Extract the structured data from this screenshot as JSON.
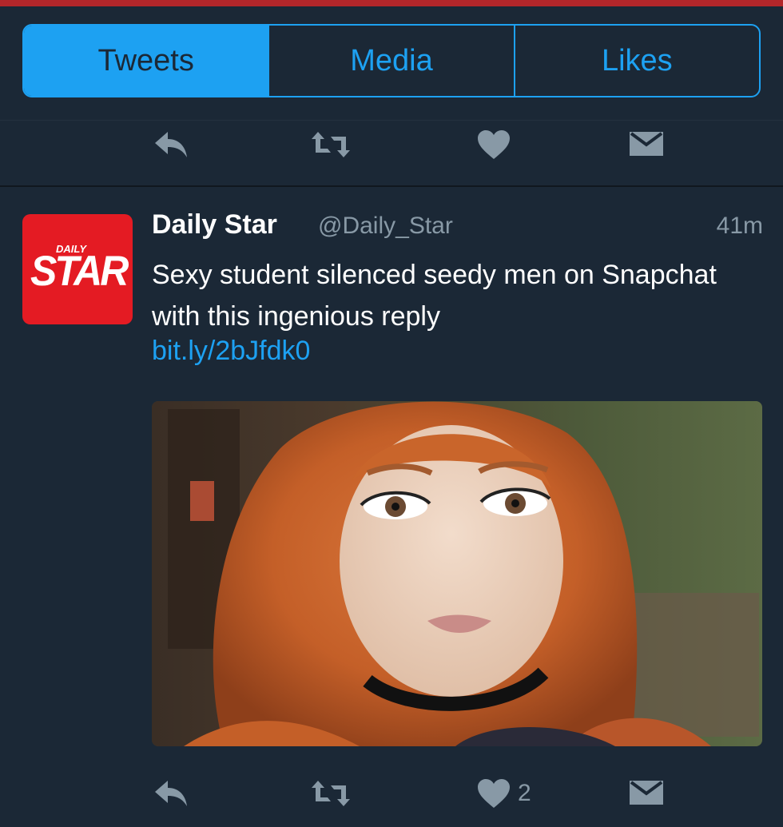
{
  "tabs": [
    {
      "label": "Tweets",
      "active": true
    },
    {
      "label": "Media",
      "active": false
    },
    {
      "label": "Likes",
      "active": false
    }
  ],
  "actions_top": {
    "reply_icon": "reply-icon",
    "retweet_icon": "retweet-icon",
    "like_icon": "heart-icon",
    "dm_icon": "envelope-icon"
  },
  "tweet": {
    "avatar": {
      "small_text": "DAILY",
      "big_text": "STAR",
      "color": "#e41b23"
    },
    "name": "Daily Star",
    "handle": "@Daily_Star",
    "time": "41m",
    "text": "Sexy student silenced seedy men on Snapchat with this ingenious reply",
    "link": "bit.ly/2bJfdk0",
    "actions": {
      "like_count": "2"
    }
  },
  "colors": {
    "background": "#1b2836",
    "accent": "#1da1f2",
    "muted": "#8899a6",
    "brand_red": "#b3262a"
  }
}
